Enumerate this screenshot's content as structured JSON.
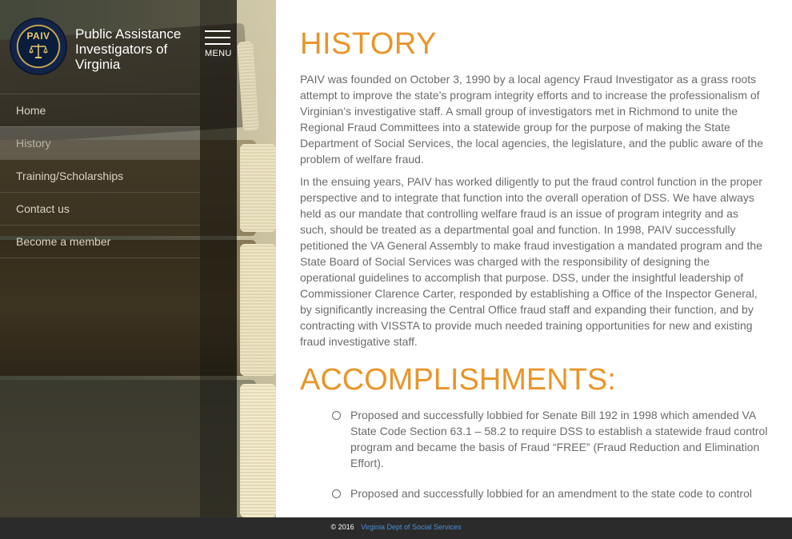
{
  "brand": {
    "logo_text": "PAIV",
    "title": "Public Assistance Investigators of Virginia"
  },
  "menu": {
    "label": "MENU"
  },
  "nav": {
    "items": [
      {
        "label": "Home"
      },
      {
        "label": "History"
      },
      {
        "label": "Training/Scholarships"
      },
      {
        "label": "Contact us"
      },
      {
        "label": "Become a member"
      }
    ],
    "active": "History"
  },
  "main": {
    "heading": "HISTORY",
    "paragraphs": [
      "PAIV was founded on October 3, 1990 by a local agency Fraud Investigator as a grass roots attempt to improve the state’s program integrity efforts and to increase the professionalism of Virginian’s investigative staff. A small group of investigators met in Richmond to unite the Regional Fraud Committees into a statewide group for the purpose of making the State Department of Social Services, the local agencies, the legislature, and the public aware of the problem of welfare fraud.",
      "In the ensuing years, PAIV has worked diligently to put the fraud control function in the proper perspective and to integrate that function into the overall operation of DSS. We have always held as our mandate that controlling welfare fraud is an issue of program integrity and as such, should be treated as a departmental goal and function. In 1998, PAIV successfully petitioned the VA General Assembly to make fraud investigation a mandated program and the State Board of Social Services was charged with the responsibility of designing the operational guidelines to accomplish that purpose. DSS, under the insightful leadership of Commissioner Clarence Carter, responded by establishing a Office of the Inspector General, by significantly increasing the Central Office fraud staff and expanding their function, and by contracting with VISSTA to provide much needed training opportunities for new and existing fraud investigative staff."
    ],
    "accomplishments_heading": "ACCOMPLISHMENTS:",
    "accomplishments": [
      "Proposed and successfully lobbied for Senate Bill 192 in 1998 which amended VA State Code Section 63.1 – 58.2 to require DSS to establish a statewide fraud control program and became the basis of Fraud “FREE” (Fraud Reduction and Elimination Effort).",
      "Proposed and successfully lobbied for an amendment to the state code to control"
    ]
  },
  "footer": {
    "copyright": "© 2016",
    "link": "Virginia Dept of Social Services"
  },
  "colors": {
    "accent": "#e9952a",
    "body_text": "#6b6b6b",
    "footer_link": "#4a90d9"
  }
}
